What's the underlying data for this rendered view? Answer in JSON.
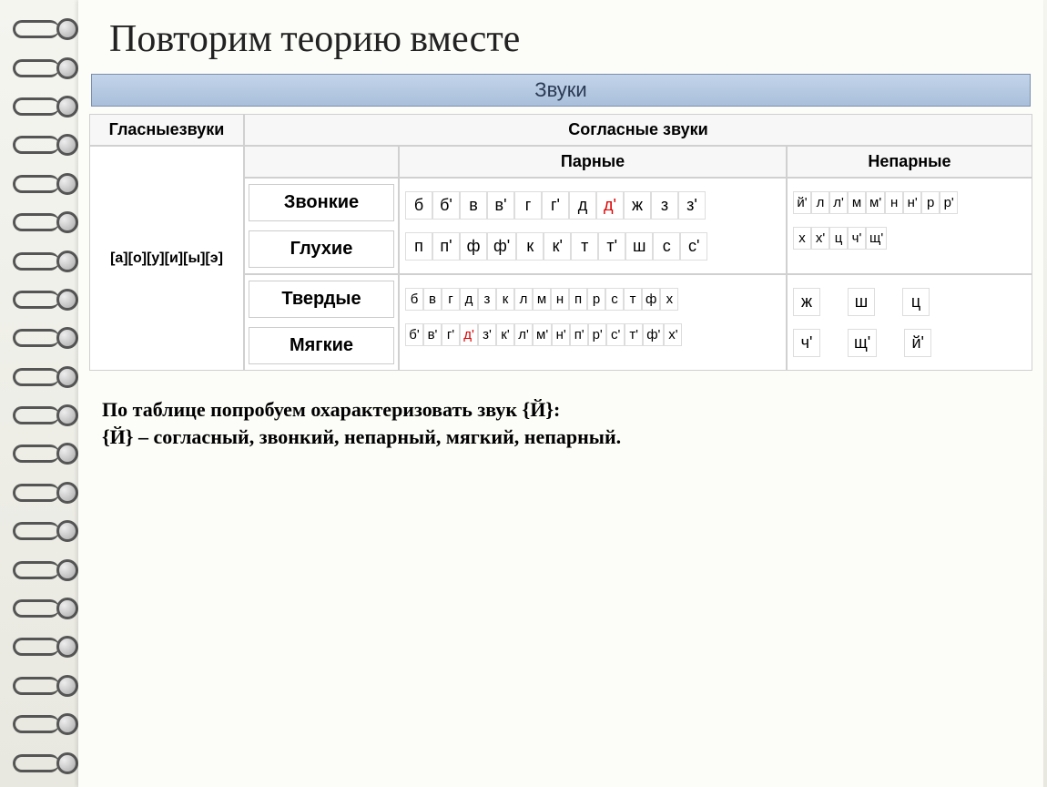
{
  "title": "Повторим теорию вместе",
  "banner": "Звуки",
  "headers": {
    "vowels": "Гласныезвуки",
    "consonants": "Согласные звуки",
    "paired": "Парные",
    "unpaired": "Непарные"
  },
  "vowel_list": "[а][о][у][и][ы][э]",
  "row_labels": {
    "voiced": "Звонкие",
    "voiceless": "Глухие",
    "hard": "Твердые",
    "soft": "Мягкие"
  },
  "paired": {
    "voiced": [
      "б",
      "б'",
      "в",
      "в'",
      "г",
      "г'",
      "д",
      "д'",
      "ж",
      "з",
      "з'"
    ],
    "voiced_red_index": 7,
    "voiceless": [
      "п",
      "п'",
      "ф",
      "ф'",
      "к",
      "к'",
      "т",
      "т'",
      "ш",
      "с",
      "с'"
    ],
    "hard": [
      "б",
      "в",
      "г",
      "д",
      "з",
      "к",
      "л",
      "м",
      "н",
      "п",
      "р",
      "с",
      "т",
      "ф",
      "х"
    ],
    "soft": [
      "б'",
      "в'",
      "г'",
      "д'",
      "з'",
      "к'",
      "л'",
      "м'",
      "н'",
      "п'",
      "р'",
      "с'",
      "т'",
      "ф'",
      "х'"
    ],
    "soft_red_index": 3
  },
  "unpaired": {
    "voiced": [
      "й'",
      "л",
      "л'",
      "м",
      "м'",
      "н",
      "н'",
      "р",
      "р'"
    ],
    "voiceless": [
      "х",
      "х'",
      "ц",
      "ч'",
      "щ'"
    ],
    "hard": [
      "ж",
      "ш",
      "ц"
    ],
    "soft": [
      "ч'",
      "щ'",
      "й'"
    ]
  },
  "footer": {
    "line1": "По таблице попробуем охарактеризовать звук  {Й}:",
    "line2": "{Й} – согласный, звонкий, непарный, мягкий, непарный."
  }
}
